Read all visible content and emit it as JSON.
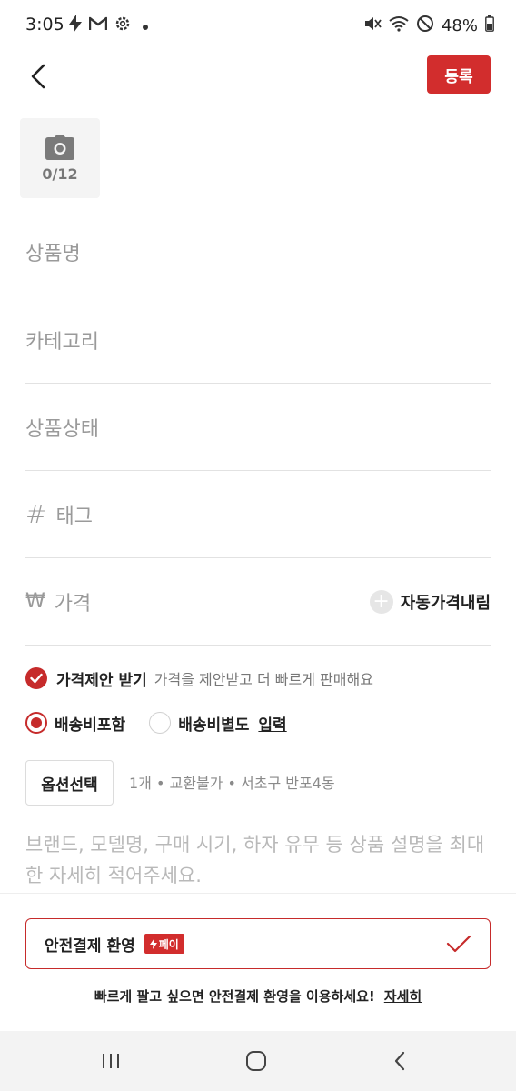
{
  "status_bar": {
    "time": "3:05",
    "battery": "48%",
    "icons": [
      "flash-icon",
      "gmail-icon",
      "settings-icon",
      "dot-icon",
      "mute-icon",
      "wifi-icon",
      "do-not-disturb-icon",
      "battery-icon"
    ]
  },
  "header": {
    "back_icon": "chevron-left-icon",
    "register_label": "등록"
  },
  "photo": {
    "icon": "camera-icon",
    "count": "0/12"
  },
  "form": {
    "product_name_placeholder": "상품명",
    "category_placeholder": "카테고리",
    "condition_placeholder": "상품상태",
    "tag_symbol": "#",
    "tag_placeholder": "태그",
    "price_symbol": "₩",
    "price_placeholder": "가격",
    "auto_price_label": "자동가격내림"
  },
  "offer": {
    "label": "가격제안 받기",
    "description": "가격을 제안받고 더 빠르게 판매해요",
    "checked": true
  },
  "shipping": {
    "included_label": "배송비포함",
    "separate_label": "배송비별도",
    "input_label": "입력",
    "selected": "included"
  },
  "option": {
    "button_label": "옵션선택",
    "summary": "1개 • 교환불가 • 서초구 반포4동"
  },
  "description": {
    "placeholder": "브랜드, 모델명, 구매 시기, 하자 유무 등 상품 설명을 최대한 자세히 적어주세요."
  },
  "safe_payment": {
    "label": "안전결제 환영",
    "badge": "페이",
    "info": "빠르게 팔고 싶으면 안전결제 환영을 이용하세요!",
    "more_link": "자세히"
  },
  "nav": {
    "icons": [
      "recent-apps-icon",
      "home-icon",
      "back-icon"
    ]
  },
  "colors": {
    "accent": "#d22d2d",
    "placeholder": "#9a9a9a",
    "divider": "#e2e2e2"
  }
}
